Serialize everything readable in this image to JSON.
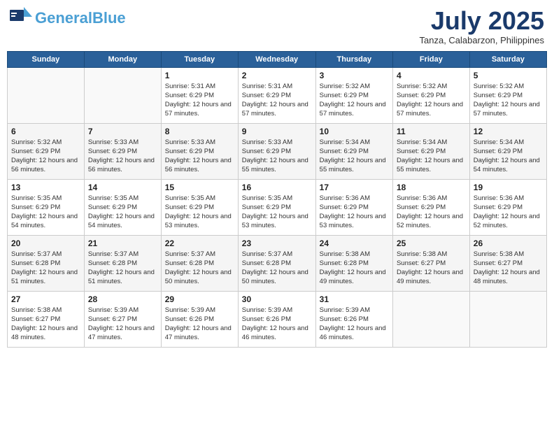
{
  "header": {
    "logo_general": "General",
    "logo_blue": "Blue",
    "month_title": "July 2025",
    "location": "Tanza, Calabarzon, Philippines"
  },
  "days_of_week": [
    "Sunday",
    "Monday",
    "Tuesday",
    "Wednesday",
    "Thursday",
    "Friday",
    "Saturday"
  ],
  "weeks": [
    [
      {
        "day": "",
        "info": ""
      },
      {
        "day": "",
        "info": ""
      },
      {
        "day": "1",
        "info": "Sunrise: 5:31 AM\nSunset: 6:29 PM\nDaylight: 12 hours and 57 minutes."
      },
      {
        "day": "2",
        "info": "Sunrise: 5:31 AM\nSunset: 6:29 PM\nDaylight: 12 hours and 57 minutes."
      },
      {
        "day": "3",
        "info": "Sunrise: 5:32 AM\nSunset: 6:29 PM\nDaylight: 12 hours and 57 minutes."
      },
      {
        "day": "4",
        "info": "Sunrise: 5:32 AM\nSunset: 6:29 PM\nDaylight: 12 hours and 57 minutes."
      },
      {
        "day": "5",
        "info": "Sunrise: 5:32 AM\nSunset: 6:29 PM\nDaylight: 12 hours and 57 minutes."
      }
    ],
    [
      {
        "day": "6",
        "info": "Sunrise: 5:32 AM\nSunset: 6:29 PM\nDaylight: 12 hours and 56 minutes."
      },
      {
        "day": "7",
        "info": "Sunrise: 5:33 AM\nSunset: 6:29 PM\nDaylight: 12 hours and 56 minutes."
      },
      {
        "day": "8",
        "info": "Sunrise: 5:33 AM\nSunset: 6:29 PM\nDaylight: 12 hours and 56 minutes."
      },
      {
        "day": "9",
        "info": "Sunrise: 5:33 AM\nSunset: 6:29 PM\nDaylight: 12 hours and 55 minutes."
      },
      {
        "day": "10",
        "info": "Sunrise: 5:34 AM\nSunset: 6:29 PM\nDaylight: 12 hours and 55 minutes."
      },
      {
        "day": "11",
        "info": "Sunrise: 5:34 AM\nSunset: 6:29 PM\nDaylight: 12 hours and 55 minutes."
      },
      {
        "day": "12",
        "info": "Sunrise: 5:34 AM\nSunset: 6:29 PM\nDaylight: 12 hours and 54 minutes."
      }
    ],
    [
      {
        "day": "13",
        "info": "Sunrise: 5:35 AM\nSunset: 6:29 PM\nDaylight: 12 hours and 54 minutes."
      },
      {
        "day": "14",
        "info": "Sunrise: 5:35 AM\nSunset: 6:29 PM\nDaylight: 12 hours and 54 minutes."
      },
      {
        "day": "15",
        "info": "Sunrise: 5:35 AM\nSunset: 6:29 PM\nDaylight: 12 hours and 53 minutes."
      },
      {
        "day": "16",
        "info": "Sunrise: 5:35 AM\nSunset: 6:29 PM\nDaylight: 12 hours and 53 minutes."
      },
      {
        "day": "17",
        "info": "Sunrise: 5:36 AM\nSunset: 6:29 PM\nDaylight: 12 hours and 53 minutes."
      },
      {
        "day": "18",
        "info": "Sunrise: 5:36 AM\nSunset: 6:29 PM\nDaylight: 12 hours and 52 minutes."
      },
      {
        "day": "19",
        "info": "Sunrise: 5:36 AM\nSunset: 6:29 PM\nDaylight: 12 hours and 52 minutes."
      }
    ],
    [
      {
        "day": "20",
        "info": "Sunrise: 5:37 AM\nSunset: 6:28 PM\nDaylight: 12 hours and 51 minutes."
      },
      {
        "day": "21",
        "info": "Sunrise: 5:37 AM\nSunset: 6:28 PM\nDaylight: 12 hours and 51 minutes."
      },
      {
        "day": "22",
        "info": "Sunrise: 5:37 AM\nSunset: 6:28 PM\nDaylight: 12 hours and 50 minutes."
      },
      {
        "day": "23",
        "info": "Sunrise: 5:37 AM\nSunset: 6:28 PM\nDaylight: 12 hours and 50 minutes."
      },
      {
        "day": "24",
        "info": "Sunrise: 5:38 AM\nSunset: 6:28 PM\nDaylight: 12 hours and 49 minutes."
      },
      {
        "day": "25",
        "info": "Sunrise: 5:38 AM\nSunset: 6:27 PM\nDaylight: 12 hours and 49 minutes."
      },
      {
        "day": "26",
        "info": "Sunrise: 5:38 AM\nSunset: 6:27 PM\nDaylight: 12 hours and 48 minutes."
      }
    ],
    [
      {
        "day": "27",
        "info": "Sunrise: 5:38 AM\nSunset: 6:27 PM\nDaylight: 12 hours and 48 minutes."
      },
      {
        "day": "28",
        "info": "Sunrise: 5:39 AM\nSunset: 6:27 PM\nDaylight: 12 hours and 47 minutes."
      },
      {
        "day": "29",
        "info": "Sunrise: 5:39 AM\nSunset: 6:26 PM\nDaylight: 12 hours and 47 minutes."
      },
      {
        "day": "30",
        "info": "Sunrise: 5:39 AM\nSunset: 6:26 PM\nDaylight: 12 hours and 46 minutes."
      },
      {
        "day": "31",
        "info": "Sunrise: 5:39 AM\nSunset: 6:26 PM\nDaylight: 12 hours and 46 minutes."
      },
      {
        "day": "",
        "info": ""
      },
      {
        "day": "",
        "info": ""
      }
    ]
  ]
}
